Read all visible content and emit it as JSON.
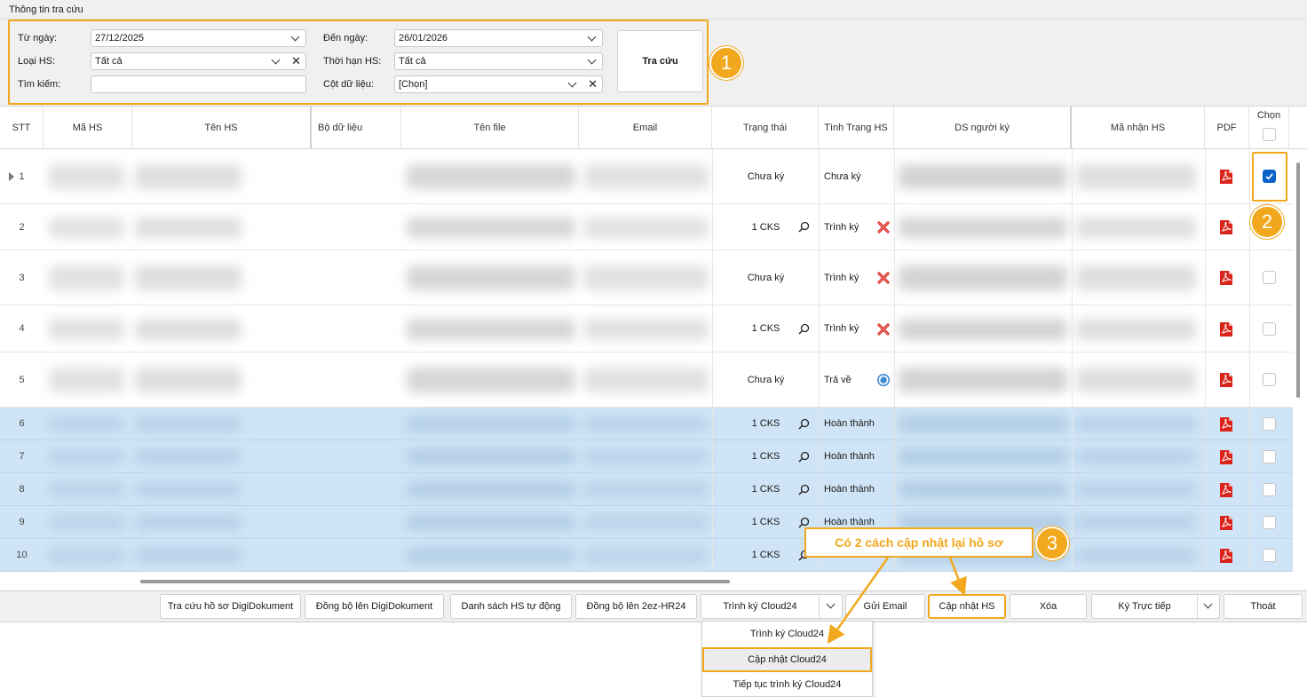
{
  "panel": {
    "title": "Thông tin tra cứu",
    "from_date_label": "Từ ngày:",
    "from_date_value": "27/12/2025",
    "to_date_label": "Đến ngày:",
    "to_date_value": "26/01/2026",
    "type_label": "Loại HS:",
    "type_value": "Tất cả",
    "term_label": "Thời hạn HS:",
    "term_value": "Tất cả",
    "search_label": "Tìm kiếm:",
    "search_value": "",
    "column_label": "Cột dữ liệu:",
    "column_value": "[Chọn]",
    "search_button": "Tra cứu"
  },
  "badges": {
    "b1": "1",
    "b2": "2",
    "b3": "3"
  },
  "columns": [
    "STT",
    "Mã HS",
    "Tên HS",
    "Bộ dữ liệu",
    "Tên file",
    "Email",
    "Trạng thái",
    "Tình Trạng HS",
    "DS người ký",
    "Mã nhận HS",
    "PDF",
    "Chọn"
  ],
  "rows": [
    {
      "stt": "1",
      "trang_thai": "Chưa ký",
      "tinh_trang": "Chưa ký",
      "detail_icon": false,
      "status_icon": "none",
      "checked": true
    },
    {
      "stt": "2",
      "trang_thai": "1 CKS",
      "tinh_trang": "Trình ký",
      "detail_icon": true,
      "status_icon": "red-x-icon",
      "checked": false
    },
    {
      "stt": "3",
      "trang_thai": "Chưa ký",
      "tinh_trang": "Trình ký",
      "detail_icon": false,
      "status_icon": "red-x-icon",
      "checked": false
    },
    {
      "stt": "4",
      "trang_thai": "1 CKS",
      "tinh_trang": "Trình ký",
      "detail_icon": true,
      "status_icon": "red-x-icon",
      "checked": false
    },
    {
      "stt": "5",
      "trang_thai": "Chưa ký",
      "tinh_trang": "Trả về",
      "detail_icon": false,
      "status_icon": "return-icon",
      "checked": false
    },
    {
      "stt": "6",
      "trang_thai": "1 CKS",
      "tinh_trang": "Hoàn thành",
      "detail_icon": true,
      "status_icon": "none",
      "checked": false
    },
    {
      "stt": "7",
      "trang_thai": "1 CKS",
      "tinh_trang": "Hoàn thành",
      "detail_icon": true,
      "status_icon": "none",
      "checked": false
    },
    {
      "stt": "8",
      "trang_thai": "1 CKS",
      "tinh_trang": "Hoàn thành",
      "detail_icon": true,
      "status_icon": "none",
      "checked": false
    },
    {
      "stt": "9",
      "trang_thai": "1 CKS",
      "tinh_trang": "Hoàn thành",
      "detail_icon": true,
      "status_icon": "none",
      "checked": false
    },
    {
      "stt": "10",
      "trang_thai": "1 CKS",
      "tinh_trang": "",
      "detail_icon": true,
      "status_icon": "none",
      "checked": false
    }
  ],
  "toolbar": {
    "btn1": "Tra cứu hồ sơ DigiDokument",
    "btn2": "Đồng bộ lên DigiDokument",
    "btn3": "Danh sách HS tự động",
    "btn4": "Đồng bộ lên 2ez-HR24",
    "btn5": "Trình ký Cloud24",
    "btn6": "Gửi Email",
    "btn7": "Cập nhật HS",
    "btn8": "Xóa",
    "btn9": "Ký Trực tiếp",
    "btn10": "Thoát"
  },
  "dropdown_menu": {
    "item1": "Trình ký Cloud24",
    "item2": "Cập nhật Cloud24",
    "item3": "Tiếp tục trình ký Cloud24"
  },
  "callout": "Có 2 cách cập nhật lại hồ sơ",
  "colors": {
    "accent": "#f2a81d",
    "selection": "#cfe4f6",
    "checkbox_checked": "#0a63c9",
    "pdf_red": "#d9251c"
  }
}
